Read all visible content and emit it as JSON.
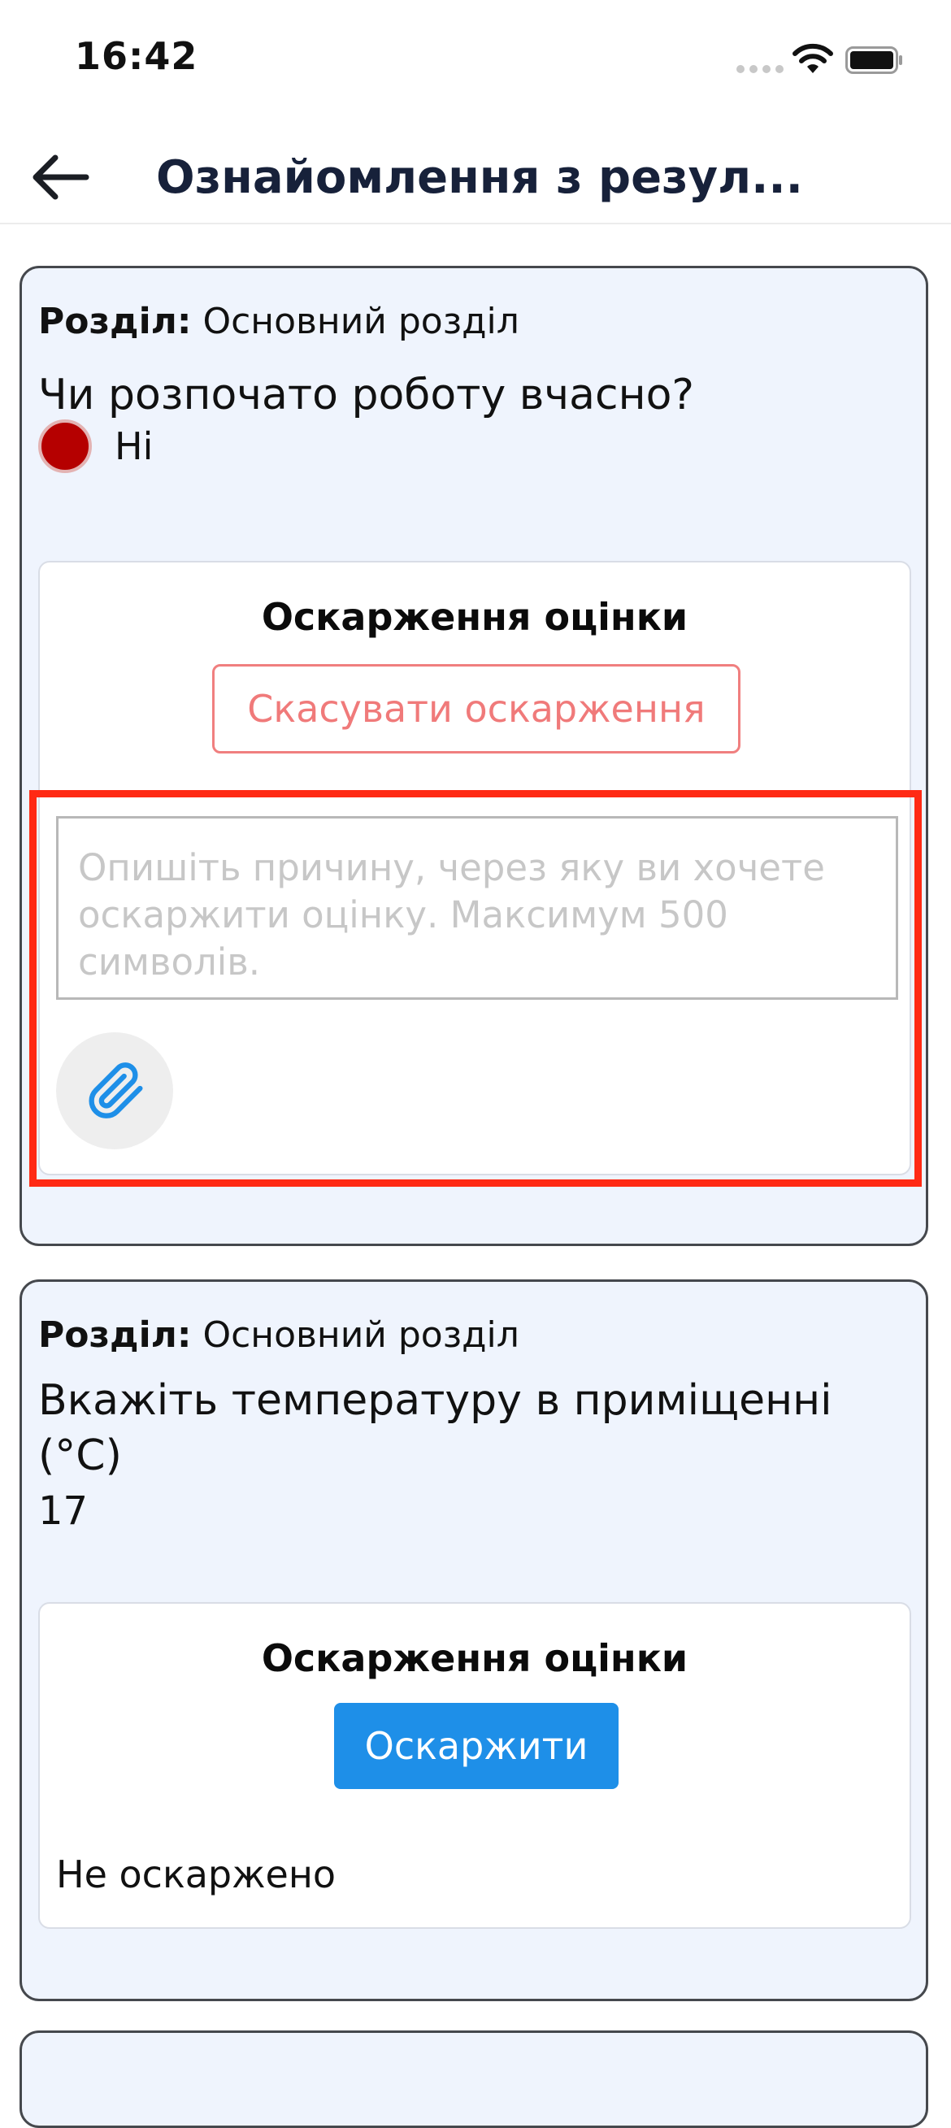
{
  "status_bar": {
    "time": "16:42",
    "icons": [
      "signal-icon",
      "wifi-icon",
      "battery-icon"
    ]
  },
  "header": {
    "back_icon": "arrow-left-icon",
    "title": "Ознайомлення з резул..."
  },
  "cards": [
    {
      "section_label": "Розділ:",
      "section_value": "Основний розділ",
      "question": "Чи розпочато роботу вчасно?",
      "answer": "Ні",
      "answer_color": "#b50000",
      "appeal": {
        "title": "Оскарження оцінки",
        "cancel_button": "Скасувати оскарження",
        "reason_placeholder": "Опишіть причину, через яку ви хочете оскаржити оцінку. Максимум 500 символів.",
        "attach_icon": "paperclip-icon"
      }
    },
    {
      "section_label": "Розділ:",
      "section_value": "Основний розділ",
      "question": "Вкажіть температуру в приміщенні (°C)",
      "answer": "17",
      "appeal": {
        "title": "Оскарження оцінки",
        "appeal_button": "Оскаржити",
        "status": "Не оскаржено"
      }
    }
  ],
  "colors": {
    "card_background": "#eff4fd",
    "primary_button": "#1e8fe8",
    "cancel_border": "#f07f7f",
    "highlight": "#ff2a14",
    "title_text": "#17213a"
  }
}
